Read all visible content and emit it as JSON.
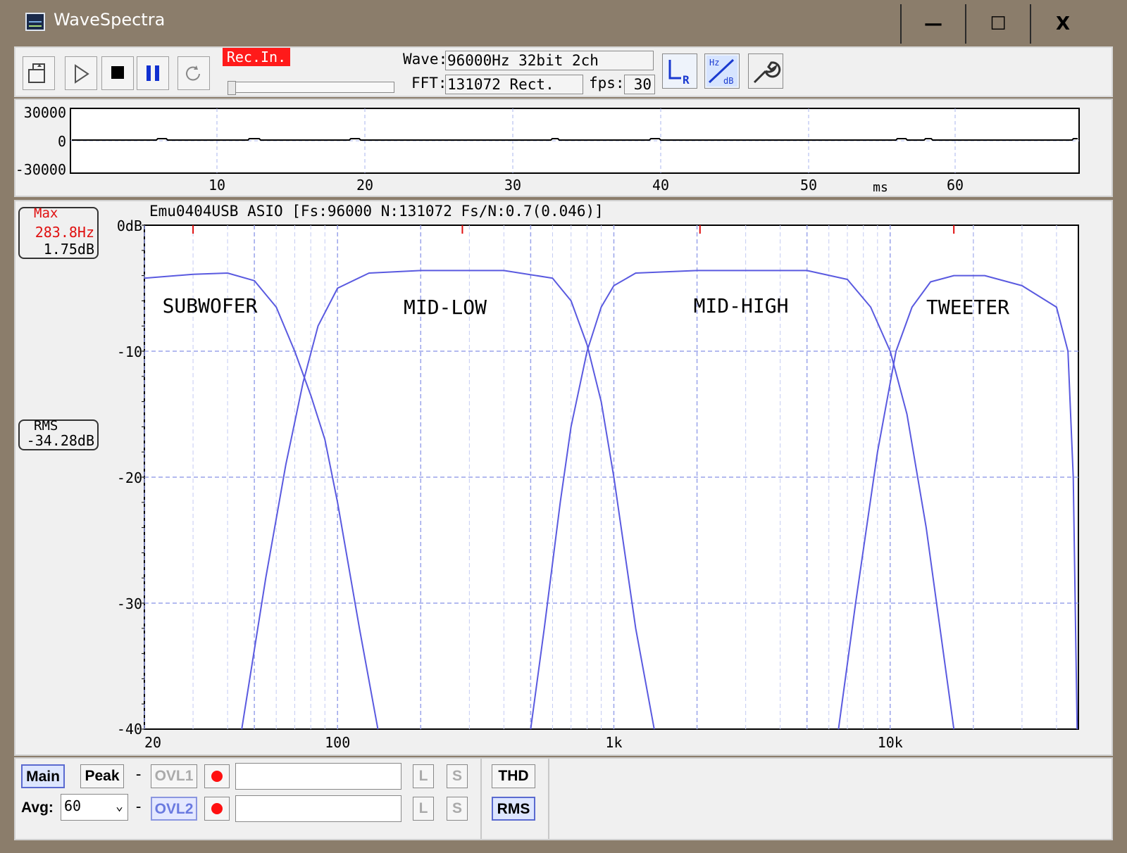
{
  "window": {
    "title": "WaveSpectra",
    "controls": {
      "minimize": "—",
      "maximize": "☐",
      "close": "X"
    }
  },
  "toolbar": {
    "rec_in": "Rec.In.",
    "wave_label": "Wave:",
    "wave_value": "96000Hz 32bit 2ch",
    "fft_label": "FFT:",
    "fft_value": "131072 Rect.",
    "fps_label": "fps:",
    "fps_value": "30",
    "buttons": [
      "open-file",
      "play",
      "stop",
      "pause",
      "loop"
    ],
    "icon_buttons": [
      "lr-channel",
      "hz-db-scale",
      "settings-wrench"
    ]
  },
  "waveform": {
    "y_ticks": [
      "30000",
      "0",
      "-30000"
    ],
    "x_ticks": [
      "10",
      "20",
      "30",
      "40",
      "50",
      "60"
    ],
    "x_unit": "ms"
  },
  "spectrum": {
    "header": "Emu0404USB ASIO  [Fs:96000 N:131072 Fs/N:0.7(0.046)]",
    "max_label": "Max",
    "max_freq": "283.8Hz",
    "max_db": "1.75dB",
    "rms_label": "RMS",
    "rms_value": "-34.28dB",
    "band_labels": [
      "SUBWOFER",
      "MID-LOW",
      "MID-HIGH",
      "TWEETER"
    ]
  },
  "chart_data": {
    "type": "line",
    "x_scale": "log",
    "xlim": [
      20,
      48000
    ],
    "ylim": [
      -40,
      0
    ],
    "x_tick_labels": [
      "20",
      "100",
      "1k",
      "10k"
    ],
    "y_tick_labels": [
      "0dB",
      "-10",
      "-20",
      "-30",
      "-40"
    ],
    "grid": true,
    "line_color": "#5a5ae0",
    "series": [
      {
        "name": "SUBWOFER",
        "x": [
          20,
          30,
          40,
          50,
          60,
          70,
          80,
          90,
          100,
          120,
          140
        ],
        "y": [
          -4.2,
          -3.9,
          -3.8,
          -4.4,
          -6.5,
          -10,
          -13.5,
          -17,
          -22,
          -32,
          -40
        ]
      },
      {
        "name": "MID-LOW",
        "x": [
          45,
          55,
          65,
          75,
          85,
          100,
          130,
          200,
          400,
          600,
          700,
          800,
          900,
          1000,
          1200,
          1400
        ],
        "y": [
          -40,
          -28,
          -19,
          -12.5,
          -8,
          -5,
          -3.8,
          -3.6,
          -3.6,
          -4.2,
          -6,
          -9.5,
          -14,
          -20,
          -32,
          -40
        ]
      },
      {
        "name": "MID-HIGH",
        "x": [
          500,
          560,
          640,
          700,
          800,
          900,
          1000,
          1200,
          2000,
          5000,
          7000,
          8500,
          10000,
          11500,
          13500,
          17000
        ],
        "y": [
          -40,
          -32,
          -22,
          -16,
          -10,
          -6.5,
          -4.8,
          -3.8,
          -3.6,
          -3.6,
          -4.3,
          -6.5,
          -10,
          -15,
          -24,
          -40
        ]
      },
      {
        "name": "TWEETER",
        "x": [
          6500,
          7500,
          9000,
          10500,
          12000,
          14000,
          17000,
          22000,
          30000,
          40000,
          44000,
          46000,
          47500
        ],
        "y": [
          -40,
          -30,
          -18,
          -10,
          -6.5,
          -4.5,
          -4,
          -4,
          -4.8,
          -6.5,
          -10,
          -20,
          -40
        ]
      }
    ],
    "peak_markers_hz": [
      30,
      283,
      2050,
      17000
    ]
  },
  "bottom": {
    "main": "Main",
    "peak": "Peak",
    "dash": "-",
    "ovl1": "OVL1",
    "ovl2": "OVL2",
    "avg_label": "Avg:",
    "avg_value": "60",
    "l": "L",
    "s": "S",
    "thd": "THD",
    "rms": "RMS"
  }
}
